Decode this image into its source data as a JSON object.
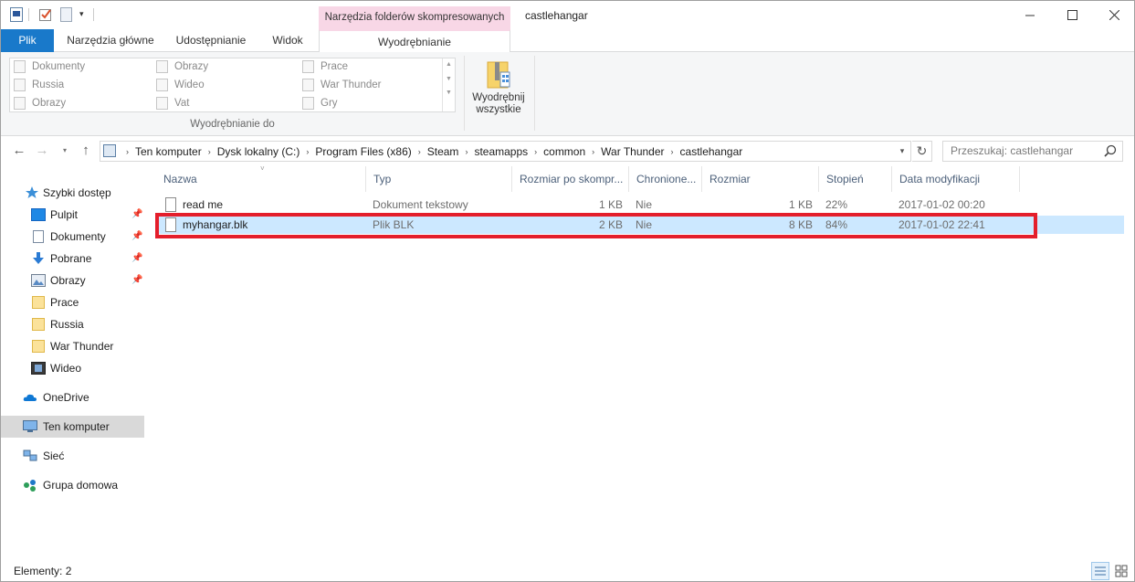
{
  "window": {
    "context_tab_header": "Narzędzia folderów skompresowanych",
    "title": "castlehangar"
  },
  "ribbon": {
    "tabs": [
      "Plik",
      "Narzędzia główne",
      "Udostępnianie",
      "Widok",
      "Wyodrębnianie"
    ],
    "gallery": [
      [
        "Dokumenty",
        "Obrazy",
        "Prace"
      ],
      [
        "Russia",
        "Wideo",
        "War Thunder"
      ],
      [
        "Obrazy",
        "Vat",
        "Gry"
      ]
    ],
    "group_label": "Wyodrębnianie do",
    "extract_all_line1": "Wyodrębnij",
    "extract_all_line2": "wszystkie"
  },
  "address": {
    "crumbs": [
      "Ten komputer",
      "Dysk lokalny (C:)",
      "Program Files (x86)",
      "Steam",
      "steamapps",
      "common",
      "War Thunder",
      "castlehangar"
    ],
    "search_placeholder": "Przeszukaj: castlehangar"
  },
  "nav": {
    "quick_access": "Szybki dostęp",
    "items": [
      "Pulpit",
      "Dokumenty",
      "Pobrane",
      "Obrazy",
      "Prace",
      "Russia",
      "War Thunder",
      "Wideo"
    ],
    "onedrive": "OneDrive",
    "this_pc": "Ten komputer",
    "network": "Sieć",
    "homegroup": "Grupa domowa"
  },
  "columns": [
    "Nazwa",
    "Typ",
    "Rozmiar po skompr...",
    "Chronione...",
    "Rozmiar",
    "Stopień",
    "Data modyfikacji"
  ],
  "files": [
    {
      "name": "read me",
      "type": "Dokument tekstowy",
      "packed": "1 KB",
      "protected": "Nie",
      "size": "1 KB",
      "ratio": "22%",
      "modified": "2017-01-02 00:20"
    },
    {
      "name": "myhangar.blk",
      "type": "Plik BLK",
      "packed": "2 KB",
      "protected": "Nie",
      "size": "8 KB",
      "ratio": "84%",
      "modified": "2017-01-02 22:41"
    }
  ],
  "status": {
    "items_label": "Elementy: 2"
  },
  "colors": {
    "accent": "#1979ca",
    "context_tab": "#f8d7e6",
    "selection": "#cce8ff",
    "highlight_box": "#e41e2b"
  }
}
